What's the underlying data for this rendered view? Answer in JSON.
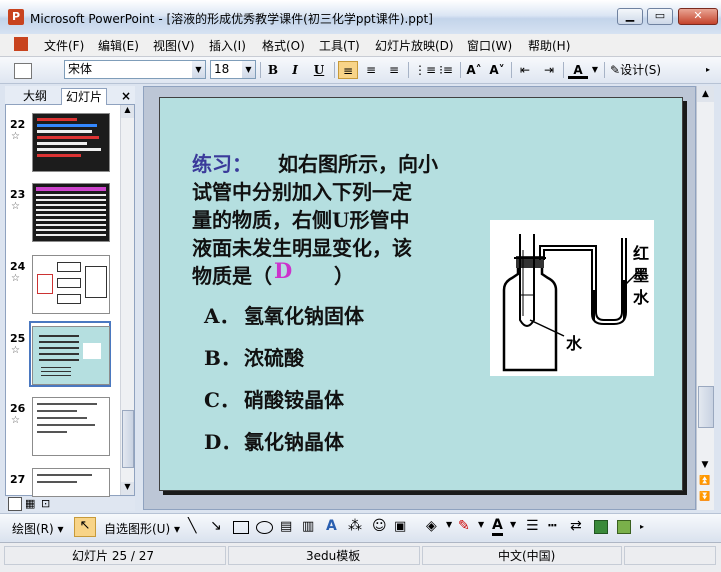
{
  "window": {
    "title": "Microsoft PowerPoint - [溶液的形成优秀教学课件(初三化学ppt课件).ppt]"
  },
  "menu": [
    "文件(F)",
    "编辑(E)",
    "视图(V)",
    "插入(I)",
    "格式(O)",
    "工具(T)",
    "幻灯片放映(D)",
    "窗口(W)",
    "帮助(H)"
  ],
  "toolbar": {
    "font_name": "宋体",
    "font_size": "18",
    "bold": "B",
    "italic": "I",
    "underline": "U",
    "design_label": "设计(S)"
  },
  "panel": {
    "tab_outline": "大纲",
    "tab_slides": "幻灯片",
    "close": "×",
    "thumbnails": [
      {
        "number": "22"
      },
      {
        "number": "23"
      },
      {
        "number": "24"
      },
      {
        "number": "25"
      },
      {
        "number": "26"
      },
      {
        "number": "27"
      }
    ]
  },
  "slide": {
    "question_label": "练习：",
    "question_line1": "如右图所示，向小",
    "question_line2": "试管中分别加入下列一定",
    "question_line3": "量的物质，右侧U形管中",
    "question_line4": "液面未发生明显变化，该",
    "question_line5_a": "物质是（",
    "question_line5_b": "）",
    "answer": "D",
    "options": [
      {
        "letter": "A．",
        "text": "氢氧化钠固体"
      },
      {
        "letter": "B．",
        "text": "浓硫酸"
      },
      {
        "letter": "C．",
        "text": "硝酸铵晶体"
      },
      {
        "letter": "D．",
        "text": "氯化钠晶体"
      }
    ],
    "figure_label_ink_1": "红",
    "figure_label_ink_2": "墨",
    "figure_label_ink_3": "水",
    "figure_label_water": "水"
  },
  "drawing_toolbar": {
    "draw_label": "绘图(R)",
    "autoshape_label": "自选图形(U)"
  },
  "status": {
    "slide_position": "幻灯片 25 / 27",
    "template": "3edu模板",
    "language": "中文(中国)"
  },
  "colors": {
    "slide_bg": "#b5dfe0",
    "label_blue": "#3a3a9a",
    "answer_magenta": "#cc33cc"
  }
}
